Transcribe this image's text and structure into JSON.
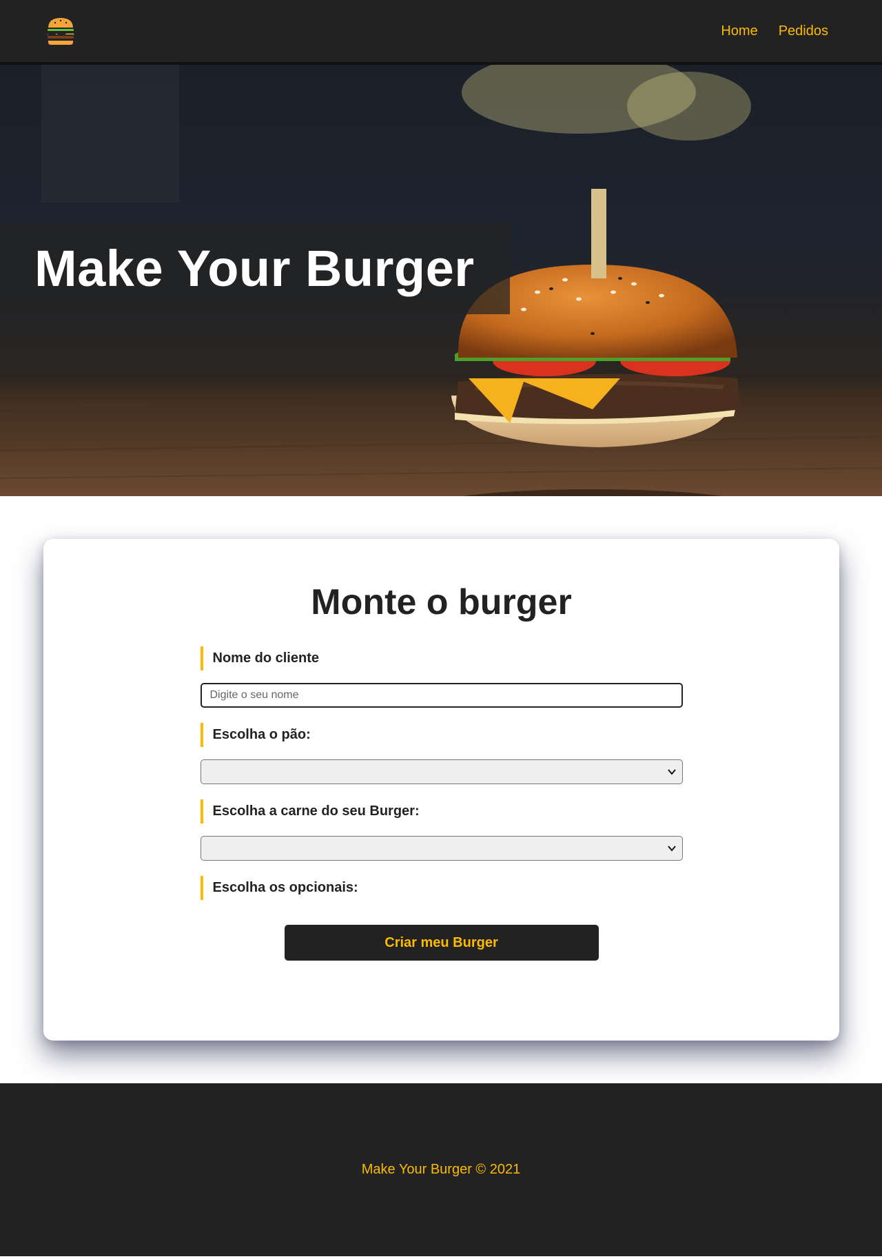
{
  "nav": {
    "logo_icon": "burger-logo-icon",
    "links": [
      {
        "label": "Home"
      },
      {
        "label": "Pedidos"
      }
    ],
    "link_color": "#fcba03"
  },
  "hero": {
    "title": "Make Your Burger"
  },
  "form": {
    "title": "Monte o burger",
    "name_label": "Nome do cliente",
    "name_placeholder": "Digite o seu nome",
    "name_value": "",
    "bread_label": "Escolha o pão:",
    "bread_selected": "",
    "meat_label": "Escolha a carne do seu Burger:",
    "meat_selected": "",
    "optionals_label": "Escolha os opcionais:",
    "submit_label": "Criar meu Burger"
  },
  "footer": {
    "text": "Make Your Burger © 2021"
  },
  "colors": {
    "accent": "#fcba03",
    "dark": "#222222"
  }
}
